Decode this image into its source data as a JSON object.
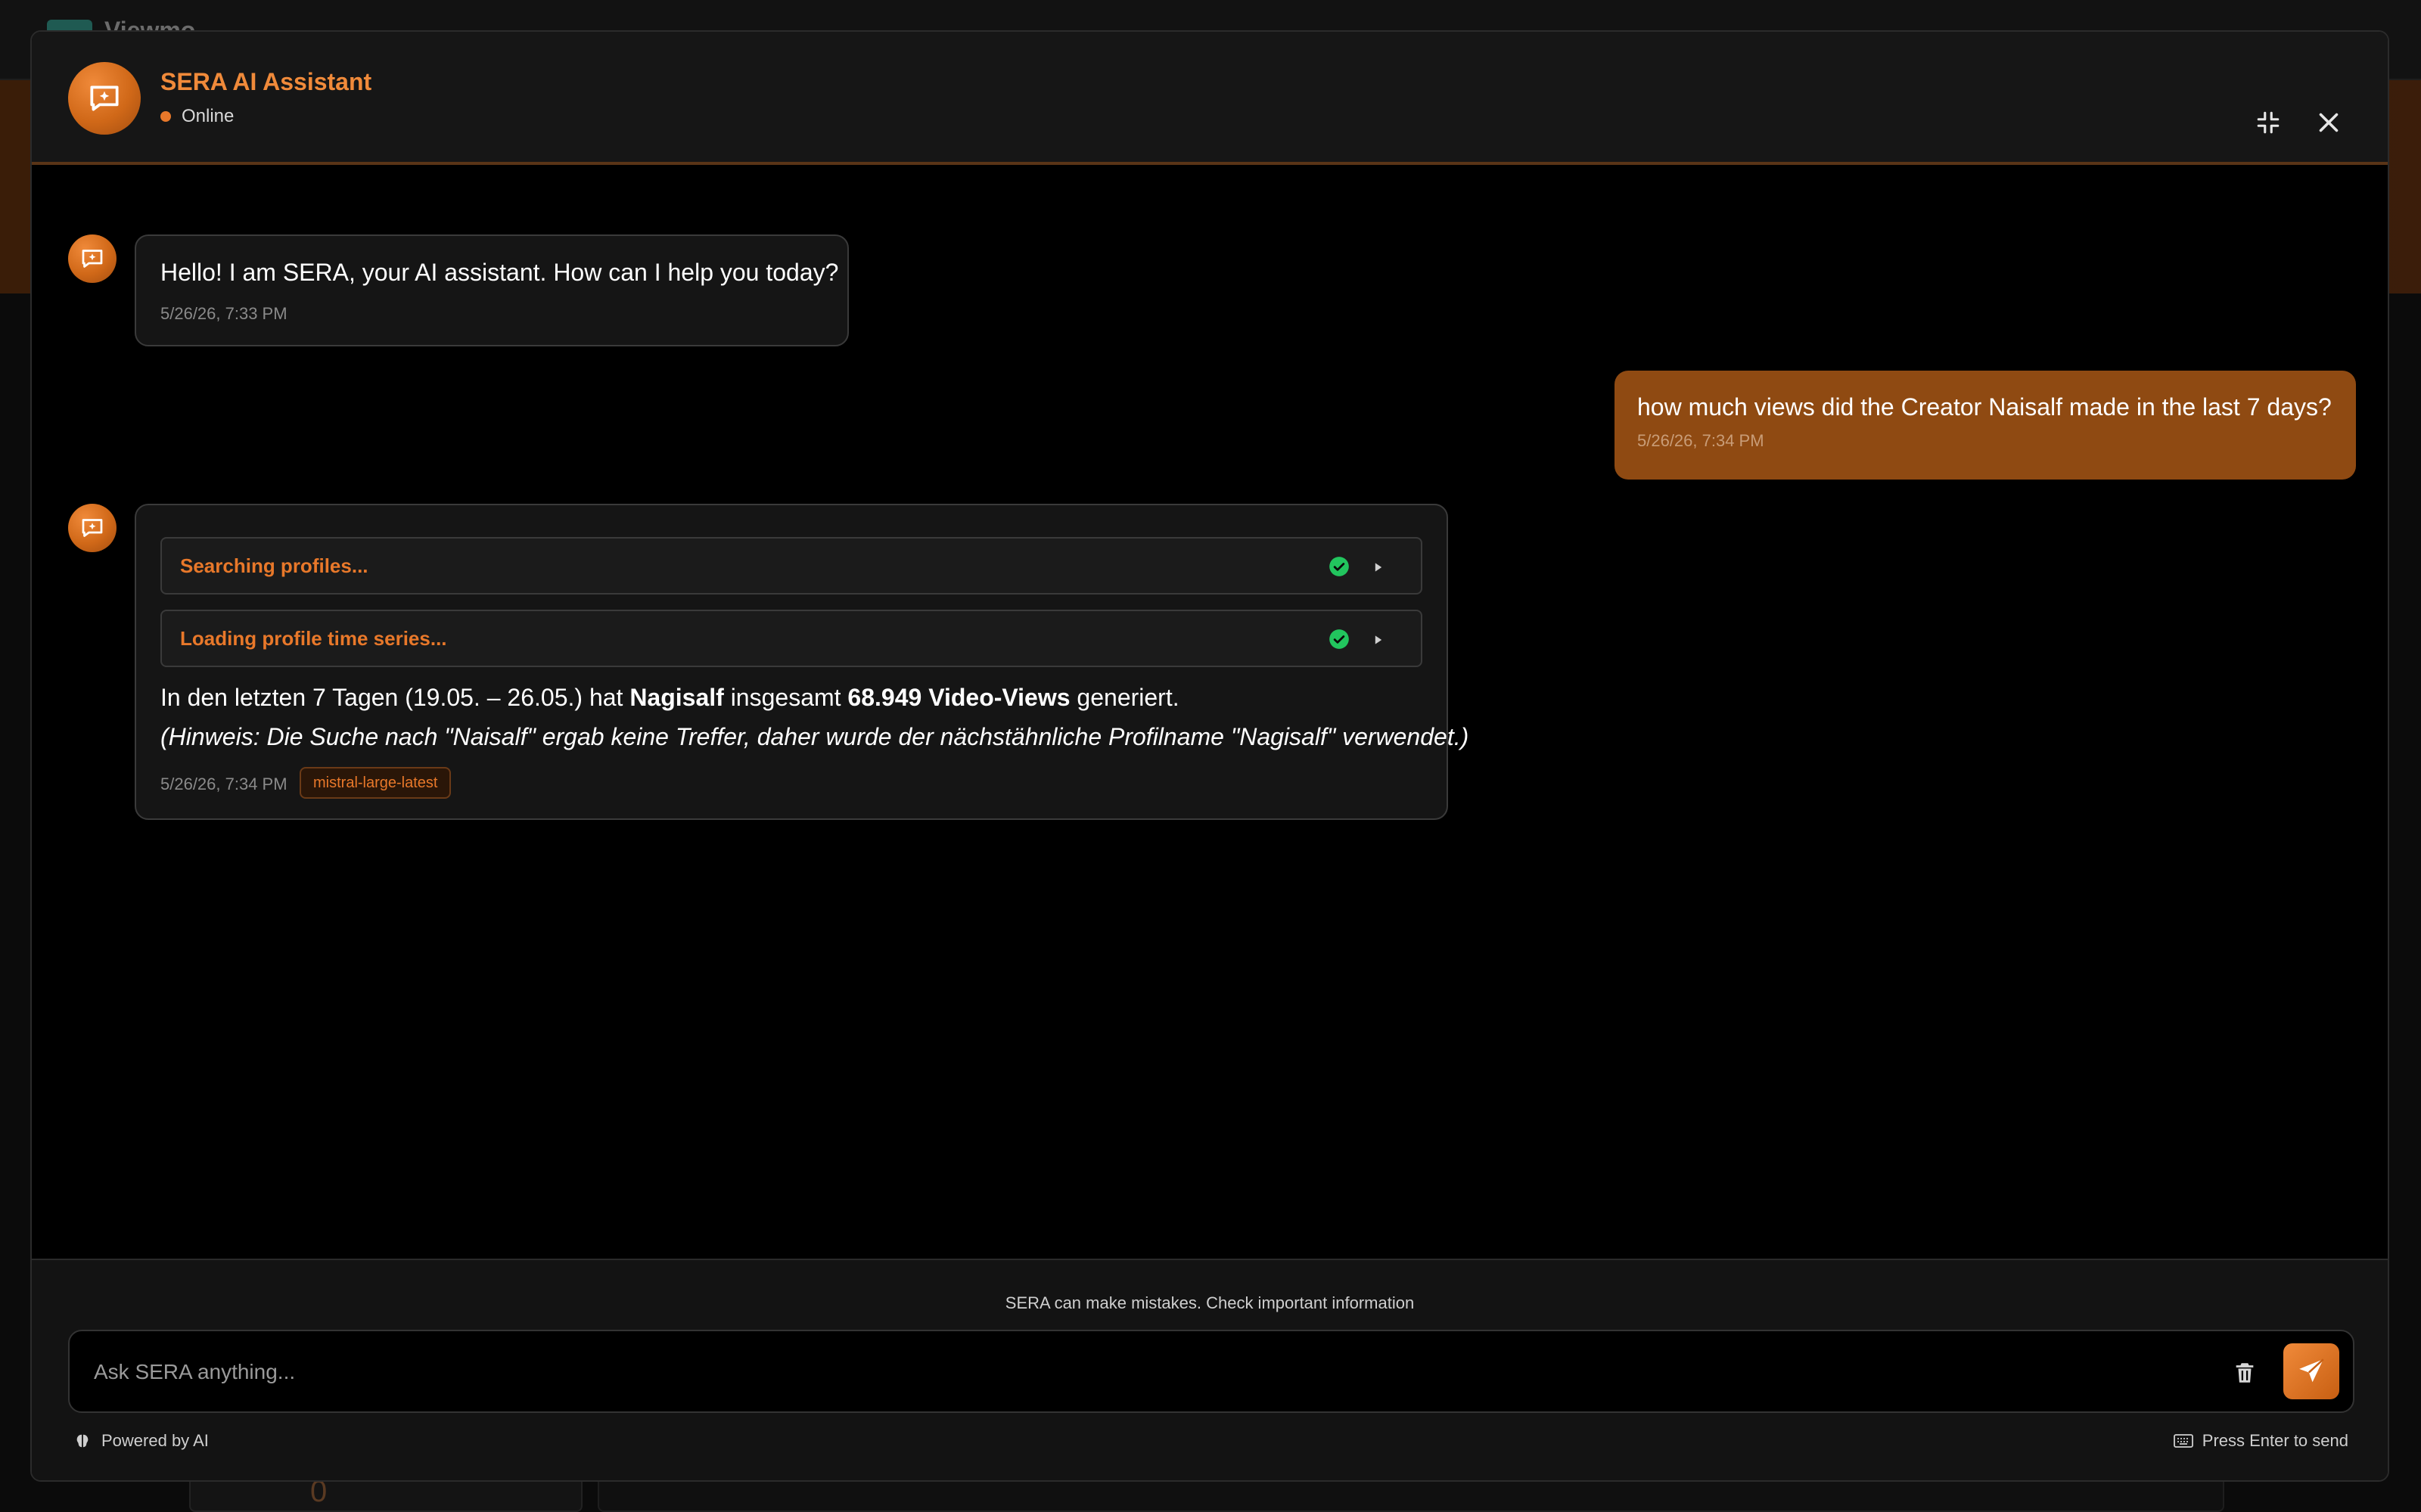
{
  "background": {
    "logo_text": "Viewmo",
    "card_number": "0"
  },
  "header": {
    "title": "SERA AI Assistant",
    "status": "Online",
    "avatar_icon": "chat-sparkle-icon",
    "minimize_icon": "minimize-icon",
    "close_icon": "close-icon"
  },
  "messages": [
    {
      "role": "assistant",
      "text": "Hello! I am SERA, your AI assistant. How can I help you today?",
      "time": "5/26/26, 7:33 PM"
    },
    {
      "role": "user",
      "text": "how much views did the Creator Naisalf made in the last 7 days?",
      "time": "5/26/26, 7:34 PM"
    },
    {
      "role": "assistant",
      "tools": [
        {
          "label": "Searching profiles...",
          "status": "done"
        },
        {
          "label": "Loading profile time series...",
          "status": "done"
        }
      ],
      "answer": {
        "part1": "In den letzten 7 Tagen (19.05. – 26.05.) hat ",
        "profile": "Nagisalf",
        "part2": " insgesamt ",
        "views": "68.949 Video-Views",
        "part3": " generiert.",
        "note": "(Hinweis: Die Suche nach \"Naisalf\" ergab keine Treffer, daher wurde der nächstähnliche Profilname \"Nagisalf\" verwendet.)"
      },
      "time": "5/26/26, 7:34 PM",
      "model": "mistral-large-latest"
    }
  ],
  "footer": {
    "disclaimer": "SERA can make mistakes. Check important information",
    "input_placeholder": "Ask SERA anything...",
    "input_value": "",
    "powered_by": "Powered by AI",
    "send_hint": "Press Enter to send"
  },
  "colors": {
    "accent": "#e8782a",
    "user_bubble": "#8f4a12",
    "success": "#22c55e"
  }
}
